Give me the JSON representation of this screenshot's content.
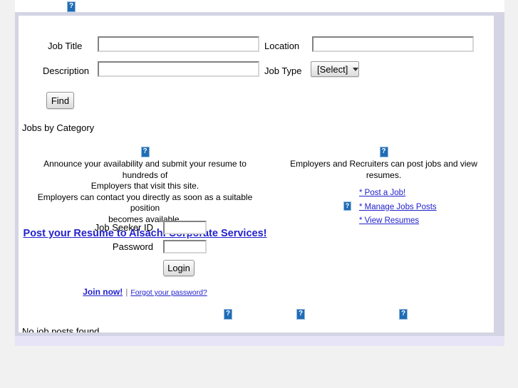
{
  "page": {
    "background_color": "#f1f1f1",
    "panel_border_color": "#d4d4e4",
    "panel_background": "#ffffff",
    "link_color": "#2222cc",
    "broken_image_color": "#1f6cb6"
  },
  "search_form": {
    "job_title_label": "Job Title",
    "job_title_value": "",
    "location_label": "Location",
    "location_value": "",
    "description_label": "Description",
    "description_value": "",
    "job_type_label": "Job Type",
    "job_type_selected": "[Select]",
    "find_button": "Find"
  },
  "jobs_by_category_label": "Jobs by Category",
  "seeker_column": {
    "blurb_line_1": "Announce your availability and submit your resume to hundreds of",
    "blurb_line_2": "Employers that visit this site.",
    "blurb_line_3": "Employers can contact you directly as soon as a suitable position",
    "blurb_line_4": "becomes available.",
    "resume_link": "Post your Resume to Alsachi Corporate Services!"
  },
  "employer_column": {
    "blurb": "Employers and Recruiters can post jobs and view resumes.",
    "links": [
      "* Post a Job!",
      "* Manage Jobs Posts",
      "* View Resumes"
    ]
  },
  "login": {
    "seeker_id_label": "Job Seeker ID",
    "seeker_id_value": "",
    "password_label": "Password",
    "password_value": "",
    "login_button": "Login",
    "join_link": "Join now!",
    "separator": "|",
    "forgot_link": "Forgot your password?"
  },
  "results": {
    "message": "No job posts found."
  },
  "icons": {
    "broken_image": "broken-image-icon",
    "dropdown_arrow": "chevron-down-icon"
  }
}
